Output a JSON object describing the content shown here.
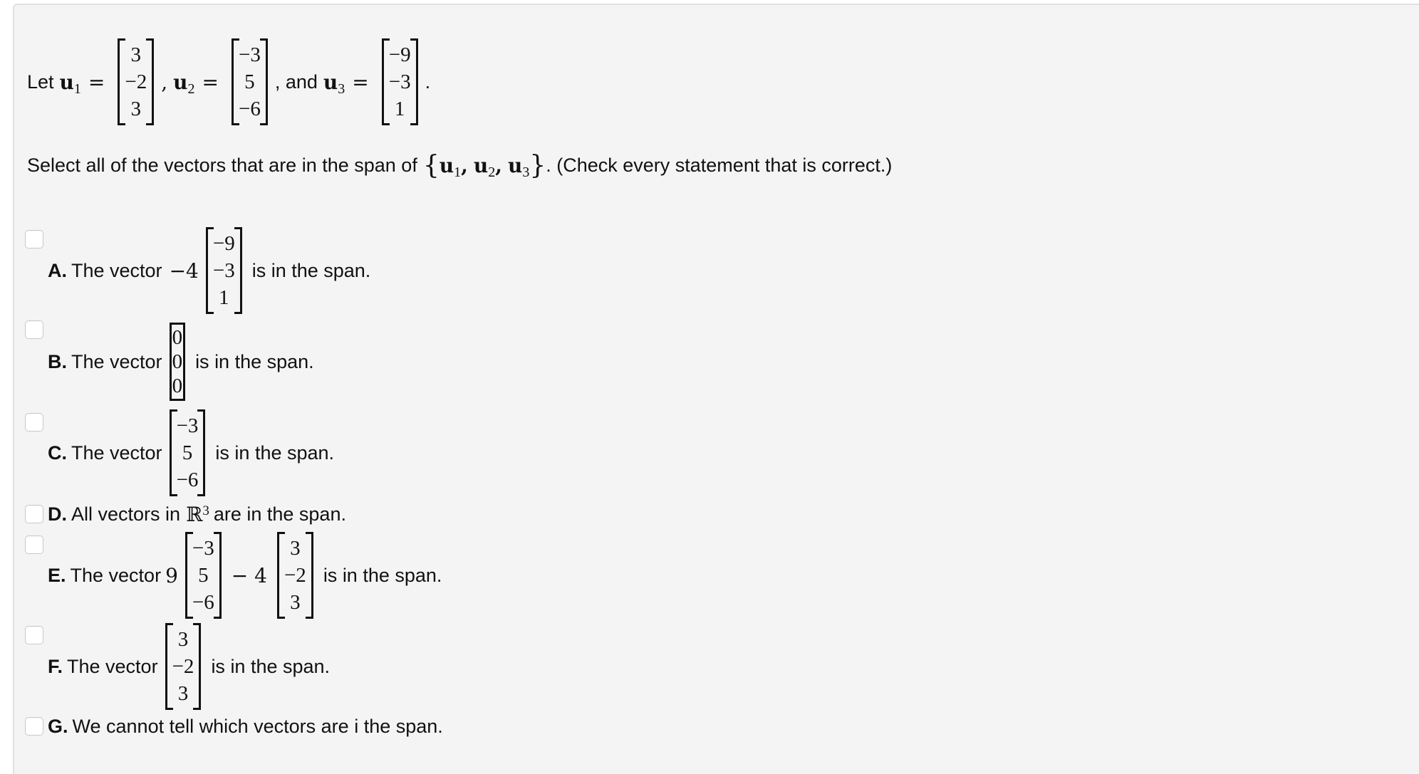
{
  "intro": {
    "let_label": "Let",
    "u1_name": "u",
    "u1_sub": "1",
    "u1": [
      "3",
      "−2",
      "3"
    ],
    "u2_name": "u",
    "u2_sub": "2",
    "u2": [
      "−3",
      "5",
      "−6"
    ],
    "and_label": ", and",
    "u3_name": "u",
    "u3_sub": "3",
    "u3": [
      "−9",
      "−3",
      "1"
    ],
    "equals": "=",
    "comma": ",",
    "period": "."
  },
  "prompt": {
    "text_before": "Select all of the vectors that are in the span of",
    "set_open": "{",
    "set_items": "u",
    "set_close": "}",
    "text_after": ". (Check every statement that is correct.)"
  },
  "options": [
    {
      "letter": "A.",
      "prefix": "The vector",
      "coef": "−4",
      "vector": [
        "−9",
        "−3",
        "1"
      ],
      "suffix": "is in the span.",
      "checked": false
    },
    {
      "letter": "B.",
      "prefix": "The vector",
      "vector": [
        "0",
        "0",
        "0"
      ],
      "suffix": "is in the span.",
      "checked": false
    },
    {
      "letter": "C.",
      "prefix": "The vector",
      "vector": [
        "−3",
        "5",
        "−6"
      ],
      "suffix": "is in the span.",
      "checked": false
    },
    {
      "letter": "D.",
      "text_before": "All vectors in",
      "space": "ℝ",
      "power": "3",
      "text_after": "are in the span.",
      "checked": false
    },
    {
      "letter": "E.",
      "prefix": "The vector",
      "coef1": "9",
      "vector1": [
        "−3",
        "5",
        "−6"
      ],
      "op": "− 4",
      "vector2": [
        "3",
        "−2",
        "3"
      ],
      "suffix": "is in the span.",
      "checked": false
    },
    {
      "letter": "F.",
      "prefix": "The vector",
      "vector": [
        "3",
        "−2",
        "3"
      ],
      "suffix": "is in the span.",
      "checked": false
    },
    {
      "letter": "G.",
      "text": "We cannot tell which vectors are i the span.",
      "checked": false
    }
  ]
}
